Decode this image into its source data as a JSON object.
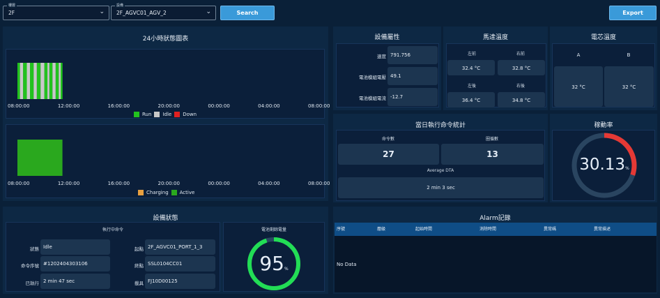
{
  "filters": {
    "floor_label": "樓層",
    "floor_value": "2F",
    "device_label": "設備",
    "device_value": "2F_AGVC01_AGV_2",
    "search_label": "Search",
    "export_label": "Export"
  },
  "chart24": {
    "title": "24小時狀態圖表",
    "ticks": [
      "08:00:00",
      "12:00:00",
      "16:00:00",
      "20:00:00",
      "00:00:00",
      "04:00:00",
      "08:00:00"
    ],
    "legend1": [
      "Run",
      "Idle",
      "Down"
    ],
    "legend2": [
      "Charging",
      "Active"
    ]
  },
  "chart_data": [
    {
      "type": "bar",
      "title": "24小時狀態圖表",
      "x": [
        "08:00:00",
        "12:00:00",
        "16:00:00",
        "20:00:00",
        "00:00:00",
        "04:00:00",
        "08:00:00"
      ],
      "series": [
        {
          "name": "Run",
          "color": "#22c21e",
          "spans": [
            [
              8.0,
              8.2
            ],
            [
              8.45,
              8.75
            ],
            [
              9.0,
              9.3
            ],
            [
              9.55,
              9.85
            ],
            [
              10.15,
              10.4
            ],
            [
              10.55,
              10.8
            ],
            [
              11.05,
              11.3
            ],
            [
              11.45,
              11.6
            ]
          ]
        },
        {
          "name": "Idle",
          "color": "#c8c8c8",
          "spans": [
            [
              8.2,
              8.45
            ],
            [
              8.75,
              9.0
            ],
            [
              9.3,
              9.55
            ],
            [
              9.85,
              10.15
            ],
            [
              10.4,
              10.55
            ],
            [
              10.8,
              11.05
            ],
            [
              11.3,
              11.45
            ]
          ]
        },
        {
          "name": "Down",
          "color": "#e02020",
          "spans": []
        }
      ]
    },
    {
      "type": "bar",
      "x": [
        "08:00:00",
        "12:00:00",
        "16:00:00",
        "20:00:00",
        "00:00:00",
        "04:00:00",
        "08:00:00"
      ],
      "series": [
        {
          "name": "Charging",
          "color": "#e8a040",
          "spans": []
        },
        {
          "name": "Active",
          "color": "#2aa81e",
          "spans": [
            [
              8.0,
              11.6
            ]
          ]
        }
      ]
    }
  ],
  "attributes": {
    "title": "設備屬性",
    "rows": [
      {
        "label": "速度",
        "value": "791.756"
      },
      {
        "label": "電池模組電壓",
        "value": "49.1"
      },
      {
        "label": "電池模組電流",
        "value": "-12.7"
      }
    ]
  },
  "motor": {
    "title": "馬達溫度",
    "fl_label": "左前",
    "fl_value": "32.4 °C",
    "fr_label": "右前",
    "fr_value": "32.8 °C",
    "rl_label": "左後",
    "rl_value": "36.4 °C",
    "rr_label": "右後",
    "rr_value": "34.8 °C"
  },
  "cell": {
    "title": "電芯溫度",
    "a_label": "A",
    "a_value": "32 °C",
    "b_label": "B",
    "b_value": "32 °C"
  },
  "commands": {
    "title": "當日執行命令統計",
    "count_label": "命令數",
    "count_value": "27",
    "loop_label": "圈循數",
    "loop_value": "13",
    "dta_label": "Average DTA",
    "dta_value": "2 min 3 sec"
  },
  "utilization": {
    "title": "稼動率",
    "value": "30.13",
    "unit": "%",
    "percent": 30.13,
    "color": "#e53935"
  },
  "status": {
    "title": "設備狀態",
    "subtitle": "執行中命令",
    "state_label": "狀態",
    "state_value": "Idle",
    "seq_label": "命令序號",
    "seq_value": "#1202404303106",
    "exec_label": "已執行",
    "exec_value": "2 min 47 sec",
    "from_label": "起點",
    "from_value": "2F_AGVC01_PORT_1_3",
    "to_label": "終點",
    "to_value": "SSL0104CC01",
    "carrier_label": "載具",
    "carrier_value": "FJ10D00125"
  },
  "battery": {
    "title": "電池剩餘電量",
    "value": "95",
    "unit": "%",
    "percent": 95,
    "color": "#22dd55"
  },
  "alarm": {
    "title": "Alarm記錄",
    "headers": [
      "序號",
      "層級",
      "起始時間",
      "消除時間",
      "異常碼",
      "異常描述"
    ],
    "empty": "No Data"
  }
}
